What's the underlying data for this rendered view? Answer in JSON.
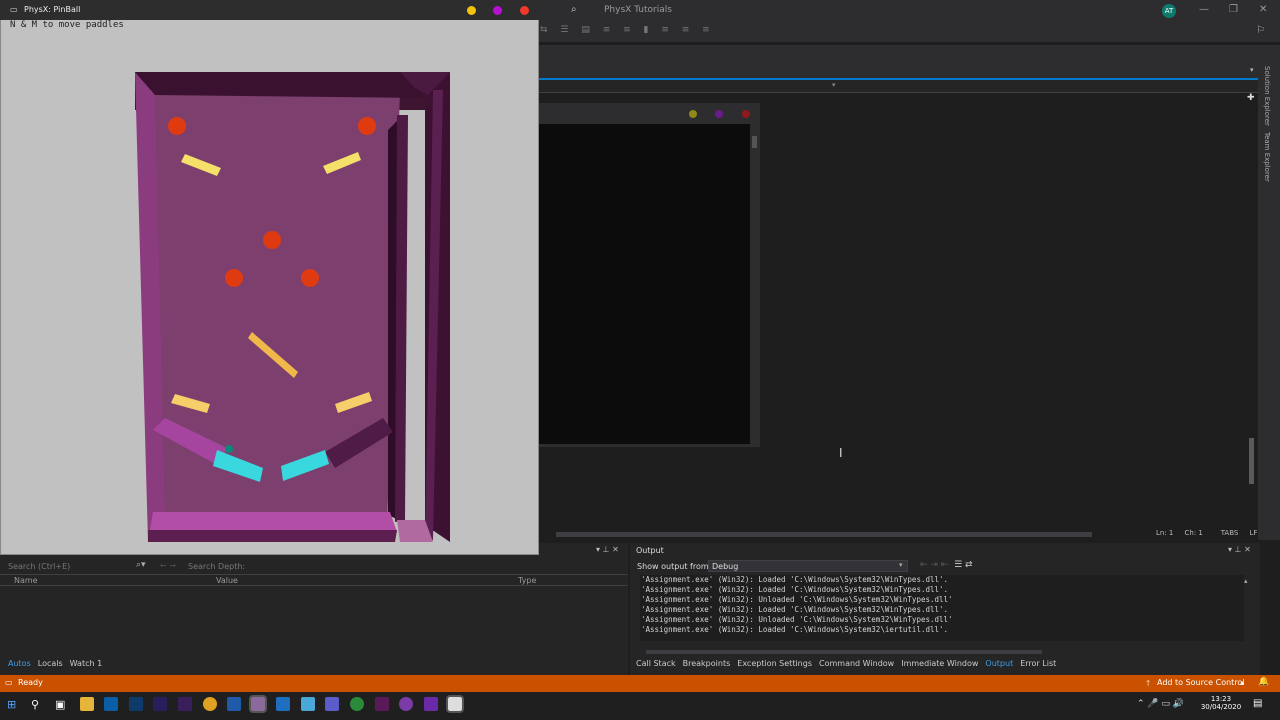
{
  "vs": {
    "title": "PhysX Tutorials",
    "account_initials": "AT",
    "status": "Ready",
    "source_control": "Add to Source Control",
    "editor_status": {
      "ln": "Ln: 1",
      "ch": "Ch: 1",
      "tabs": "TABS",
      "eol": "LF"
    },
    "side_tabs": [
      "Solution Explorer",
      "Team Explorer"
    ],
    "colors": {
      "accent": "#007acc",
      "status_bar": "#ca5100"
    }
  },
  "physx": {
    "title": "PhysX: PinBall",
    "hint": "N & M to move paddles"
  },
  "watch": {
    "search_placeholder": "Search (Ctrl+E)",
    "search_depth_label": "Search Depth:",
    "columns": [
      "Name",
      "Value",
      "Type"
    ],
    "tabs": [
      "Autos",
      "Locals",
      "Watch 1"
    ]
  },
  "output": {
    "title": "Output",
    "show_from_label": "Show output from:",
    "show_from_value": "Debug",
    "lines": [
      "'Assignment.exe' (Win32): Loaded 'C:\\Windows\\System32\\WinTypes.dll'.",
      "'Assignment.exe' (Win32): Loaded 'C:\\Windows\\System32\\WinTypes.dll'.",
      "'Assignment.exe' (Win32): Unloaded 'C:\\Windows\\System32\\WinTypes.dll'",
      "'Assignment.exe' (Win32): Loaded 'C:\\Windows\\System32\\WinTypes.dll'.",
      "'Assignment.exe' (Win32): Unloaded 'C:\\Windows\\System32\\WinTypes.dll'",
      "'Assignment.exe' (Win32): Loaded 'C:\\Windows\\System32\\iertutil.dll'."
    ],
    "tabs": [
      "Call Stack",
      "Breakpoints",
      "Exception Settings",
      "Command Window",
      "Immediate Window",
      "Output",
      "Error List"
    ]
  },
  "taskbar": {
    "time": "13:23",
    "date": "30/04/2020"
  }
}
